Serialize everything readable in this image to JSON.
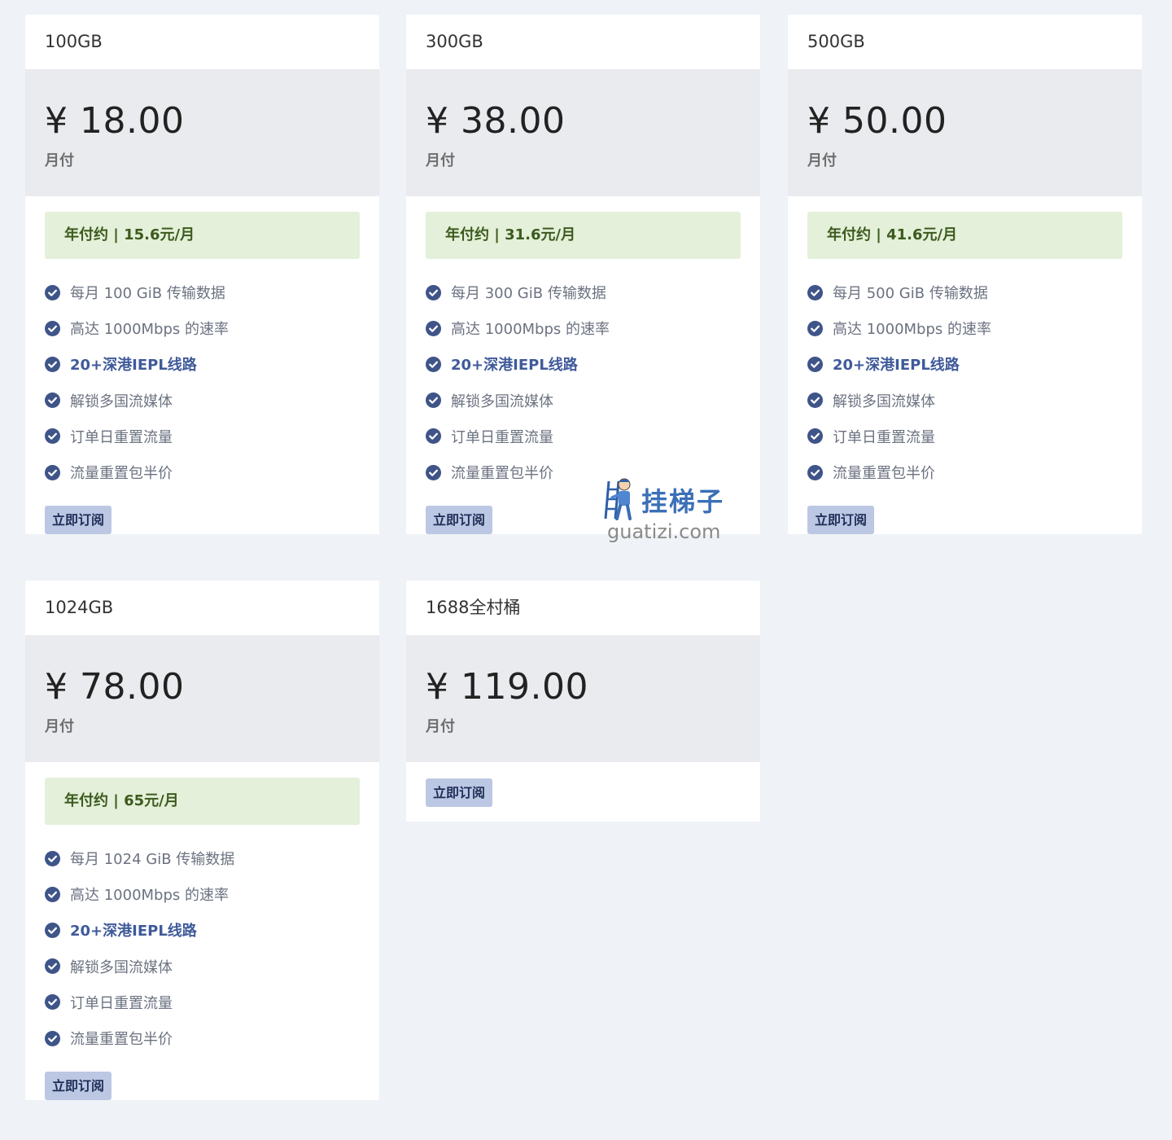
{
  "plans": [
    {
      "name": "100GB",
      "price": "¥ 18.00",
      "period": "月付",
      "annual": "年付约 | 15.6元/月",
      "features": [
        {
          "text": "每月 100 GiB 传输数据",
          "highlight": false
        },
        {
          "text": "高达 1000Mbps 的速率",
          "highlight": false
        },
        {
          "text": "20+深港IEPL线路",
          "highlight": true
        },
        {
          "text": "解锁多国流媒体",
          "highlight": false
        },
        {
          "text": "订单日重置流量",
          "highlight": false
        },
        {
          "text": "流量重置包半价",
          "highlight": false
        }
      ],
      "button": "立即订阅"
    },
    {
      "name": "300GB",
      "price": "¥ 38.00",
      "period": "月付",
      "annual": "年付约 | 31.6元/月",
      "features": [
        {
          "text": "每月 300 GiB 传输数据",
          "highlight": false
        },
        {
          "text": "高达 1000Mbps 的速率",
          "highlight": false
        },
        {
          "text": "20+深港IEPL线路",
          "highlight": true
        },
        {
          "text": "解锁多国流媒体",
          "highlight": false
        },
        {
          "text": "订单日重置流量",
          "highlight": false
        },
        {
          "text": "流量重置包半价",
          "highlight": false
        }
      ],
      "button": "立即订阅"
    },
    {
      "name": "500GB",
      "price": "¥ 50.00",
      "period": "月付",
      "annual": "年付约 | 41.6元/月",
      "features": [
        {
          "text": "每月 500 GiB 传输数据",
          "highlight": false
        },
        {
          "text": "高达 1000Mbps 的速率",
          "highlight": false
        },
        {
          "text": "20+深港IEPL线路",
          "highlight": true
        },
        {
          "text": "解锁多国流媒体",
          "highlight": false
        },
        {
          "text": "订单日重置流量",
          "highlight": false
        },
        {
          "text": "流量重置包半价",
          "highlight": false
        }
      ],
      "button": "立即订阅"
    },
    {
      "name": "1024GB",
      "price": "¥ 78.00",
      "period": "月付",
      "annual": "年付约 | 65元/月",
      "features": [
        {
          "text": "每月 1024 GiB 传输数据",
          "highlight": false
        },
        {
          "text": "高达 1000Mbps 的速率",
          "highlight": false
        },
        {
          "text": "20+深港IEPL线路",
          "highlight": true
        },
        {
          "text": "解锁多国流媒体",
          "highlight": false
        },
        {
          "text": "订单日重置流量",
          "highlight": false
        },
        {
          "text": "流量重置包半价",
          "highlight": false
        }
      ],
      "button": "立即订阅"
    },
    {
      "name": "1688全村桶",
      "price": "¥ 119.00",
      "period": "月付",
      "button": "立即订阅"
    }
  ],
  "watermark": {
    "title": "挂梯子",
    "domain": "guatizi.com"
  },
  "colors": {
    "background": "#eff2f6",
    "check_icon": "#3f5488",
    "highlight_text": "#3f5a9a",
    "annual_bg": "#e4f0d9",
    "button_bg": "#bcc8e3"
  }
}
